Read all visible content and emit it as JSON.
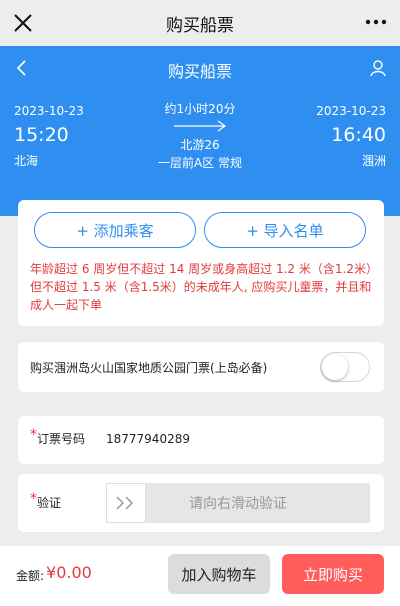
{
  "wechat_bar": {
    "title": "购买船票",
    "close_icon": "close-icon",
    "more_icon": "more-dots-icon"
  },
  "header": {
    "title": "购买船票",
    "back_icon": "chevron-left-icon",
    "user_icon": "user-icon"
  },
  "trip": {
    "departure": {
      "date": "2023-10-23",
      "time": "15:20",
      "port": "北海"
    },
    "arrival": {
      "date": "2023-10-23",
      "time": "16:40",
      "port": "涠洲"
    },
    "duration": "约1小时20分",
    "ship": "北游26",
    "cabin": "一层前A区 常规"
  },
  "passengers": {
    "add_button": "+ 添加乘客",
    "import_button": "+ 导入名单",
    "notice": "年龄超过 6 周岁但不超过 14 周岁或身高超过 1.2 米（含1.2米）但不超过 1.5 米（含1.5米）的未成年人, 应购买儿童票，并且和成人一起下单"
  },
  "park_ticket": {
    "label": "购买涠洲岛火山国家地质公园门票(上岛必备)",
    "enabled": false
  },
  "form": {
    "phone_label": "订票号码",
    "phone_value": "18777940289",
    "verify_label": "验证",
    "slider_text": "请向右滑动验证"
  },
  "footer": {
    "amount_label": "金额:",
    "currency": "¥",
    "amount": "0.00",
    "cart_button": "加入购物车",
    "buy_button": "立即购买"
  },
  "colors": {
    "primary": "#2f8ff0",
    "danger": "#e23b3b",
    "buy": "#ff5c5c",
    "background": "#ededed"
  }
}
